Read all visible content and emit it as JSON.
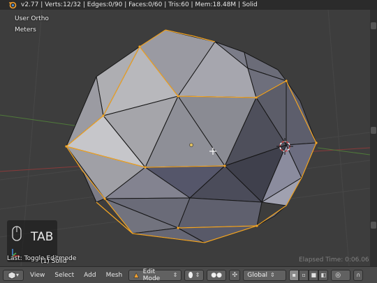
{
  "info_bar": {
    "stats": "v2.77 | Verts:12/32 | Edges:0/90 | Faces:0/60 | Tris:60 | Mem:18.48M | Solid"
  },
  "viewport": {
    "view_name": "User Ortho",
    "units": "Meters",
    "last_operator": "Last: Toggle Editmode",
    "object_name": "(1) Solid",
    "elapsed_time": "Elapsed Time: 0:06.06",
    "key_overlay": "TAB"
  },
  "header": {
    "menus": [
      "View",
      "Select",
      "Add",
      "Mesh"
    ],
    "mode": "Edit Mode",
    "orientation": "Global"
  },
  "colors": {
    "selected_edge": "#f5a623",
    "face_light": "#b0b0b6",
    "face_dark": "#5e5f6b",
    "grid": "#4a4a4a"
  }
}
